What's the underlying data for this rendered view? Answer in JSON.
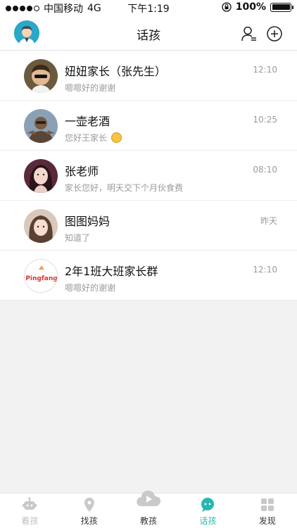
{
  "status_bar": {
    "carrier": "中国移动",
    "network": "4G",
    "time": "下午1:19",
    "battery_text": "100%"
  },
  "navbar": {
    "title": "话孩"
  },
  "chats": [
    {
      "name": "妞妞家长（张先生）",
      "preview": "嗯嗯好的谢谢",
      "time": "12:10"
    },
    {
      "name": "一壶老酒",
      "preview": "您好王家长 ",
      "time": "10:25"
    },
    {
      "name": "张老师",
      "preview": "家长您好，明天交下个月伙食费",
      "time": "08:10"
    },
    {
      "name": "图图妈妈",
      "preview": "知道了",
      "time": "昨天"
    },
    {
      "name": "2年1班大班家长群",
      "preview": "嗯嗯好的谢谢",
      "time": "12:10",
      "logo_text": "Pingfang"
    }
  ],
  "tabbar": {
    "items": [
      {
        "label": "看孩",
        "icon": "robot-icon"
      },
      {
        "label": "找孩",
        "icon": "location-icon"
      },
      {
        "label": "教孩",
        "icon": "play-cloud-icon"
      },
      {
        "label": "话孩",
        "icon": "chat-icon"
      },
      {
        "label": "发现",
        "icon": "grid-icon"
      }
    ]
  },
  "colors": {
    "accent": "#29b6b0",
    "avatar_bg": "#2aa8c9"
  }
}
